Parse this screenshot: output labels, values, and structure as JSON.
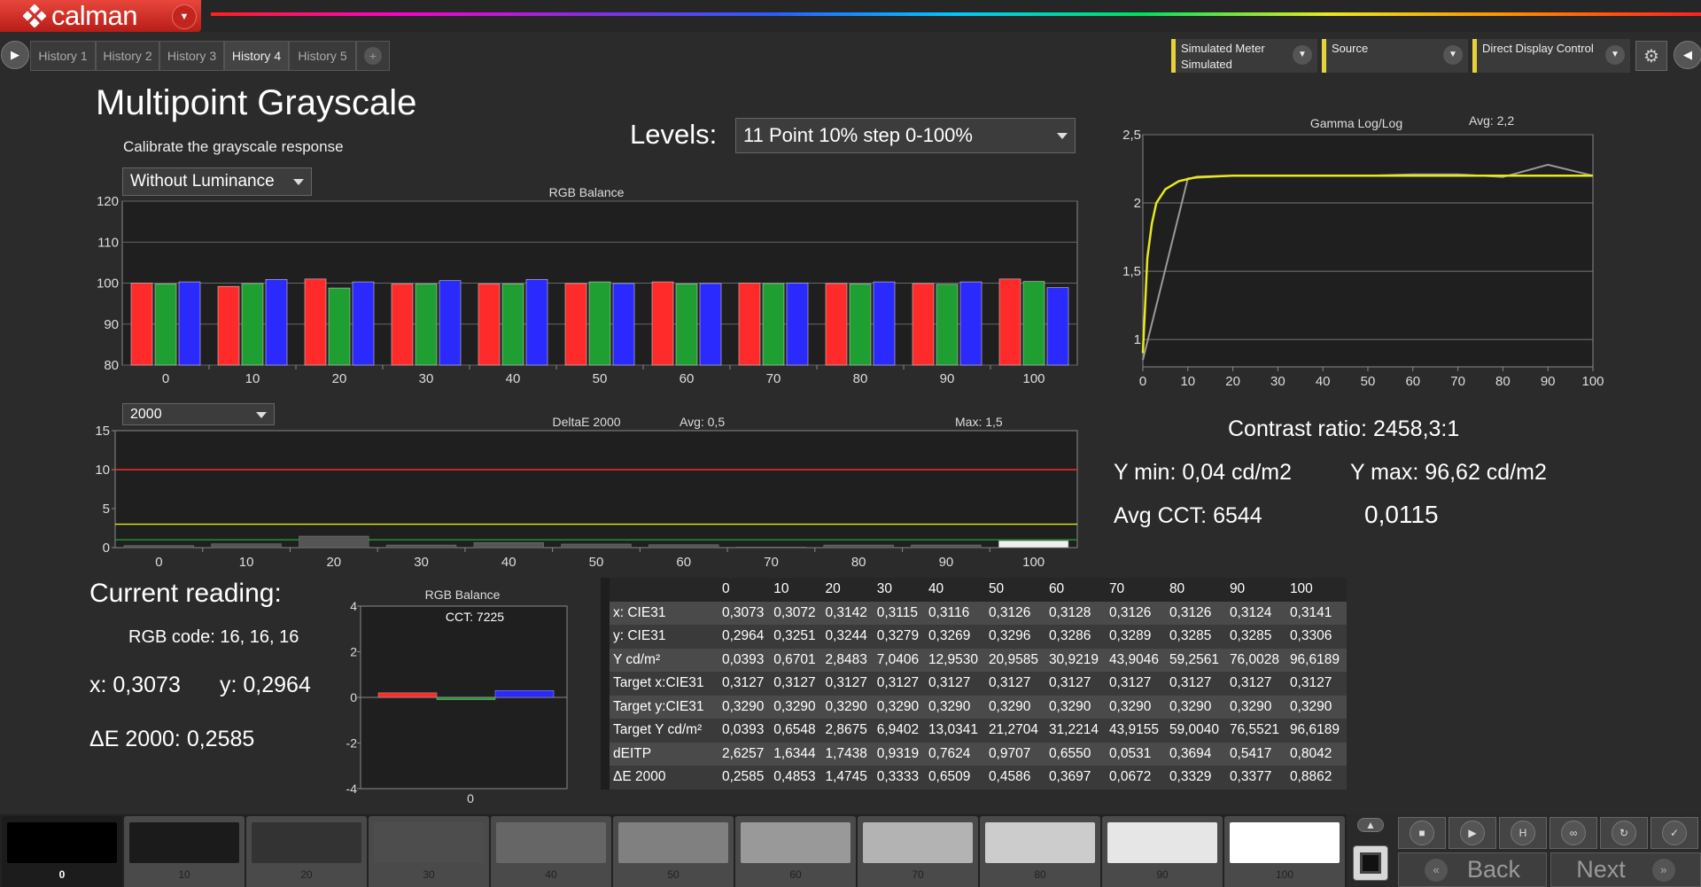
{
  "app": {
    "logo_text": "calman"
  },
  "history_tabs": [
    "History 1",
    "History 2",
    "History 3",
    "History 4",
    "History 5"
  ],
  "active_tab": 3,
  "devices": {
    "meter": {
      "line1": "Simulated Meter",
      "line2": "Simulated"
    },
    "source": {
      "line1": "Source",
      "line2": ""
    },
    "display": {
      "line1": "Direct Display Control",
      "line2": ""
    }
  },
  "page": {
    "title": "Multipoint Grayscale",
    "subtitle": "Calibrate the grayscale response",
    "levels_label": "Levels:",
    "levels_value": "11 Point 10% step 0-100%",
    "luminance_mode": "Without Luminance",
    "delta_formula": "2000"
  },
  "stats": {
    "contrast": "Contrast ratio: 2458,3:1",
    "ymin": "Y min: 0,04 cd/m2",
    "ymax": "Y max: 96,62 cd/m2",
    "avg_cct": "Avg CCT: 6544",
    "extra": "0,0115"
  },
  "current_reading": {
    "title": "Current reading:",
    "rgb": "RGB code: 16, 16, 16",
    "x": "x: 0,3073",
    "y": "y: 0,2964",
    "de": "ΔE 2000: 0,2585"
  },
  "colors": {
    "red": "#ff2a2a",
    "green": "#1f9e32",
    "blue": "#2a2aff",
    "yellow": "#e8e820",
    "accent": "#e6d23a"
  },
  "chart_data": [
    {
      "type": "bar",
      "title": "RGB Balance",
      "categories": [
        "0",
        "10",
        "20",
        "30",
        "40",
        "50",
        "60",
        "70",
        "80",
        "90",
        "100"
      ],
      "ylim": [
        80,
        120
      ],
      "yticks": [
        "80",
        "90",
        "100",
        "110",
        "120"
      ],
      "series": [
        {
          "name": "",
          "color": "#ff2a2a",
          "values": [
            100.0,
            99.2,
            101.0,
            99.8,
            99.8,
            99.9,
            100.3,
            100.0,
            99.9,
            99.9,
            101.0
          ]
        },
        {
          "name": "",
          "color": "#1f9e32",
          "values": [
            99.8,
            99.9,
            98.8,
            99.8,
            99.8,
            100.3,
            99.8,
            99.9,
            99.8,
            99.7,
            100.4
          ]
        },
        {
          "name": "",
          "color": "#2a2aff",
          "values": [
            100.3,
            100.9,
            100.3,
            100.6,
            100.9,
            99.9,
            99.9,
            100.0,
            100.3,
            100.3,
            98.9
          ]
        }
      ]
    },
    {
      "type": "bar",
      "title": "DeltaE 2000",
      "avg_label": "Avg: 0,5",
      "max_label": "Max: 1,5",
      "categories": [
        "0",
        "10",
        "20",
        "30",
        "40",
        "50",
        "60",
        "70",
        "80",
        "90",
        "100"
      ],
      "ylim": [
        0,
        15
      ],
      "yticks": [
        "0",
        "5",
        "10",
        "15"
      ],
      "thresholds": [
        {
          "value": 10,
          "color": "#ff2a2a"
        },
        {
          "value": 3,
          "color": "#e8e820"
        },
        {
          "value": 1,
          "color": "#1f9e32"
        }
      ],
      "values": [
        0.2585,
        0.4853,
        1.4745,
        0.3333,
        0.6509,
        0.4586,
        0.3697,
        0.0672,
        0.3329,
        0.3377,
        0.8862
      ]
    },
    {
      "type": "line",
      "title": "Gamma Log/Log",
      "avg_label": "Avg: 2,2",
      "x": [
        0,
        10,
        20,
        30,
        40,
        50,
        60,
        70,
        80,
        90,
        100
      ],
      "xticks": [
        "0",
        "10",
        "20",
        "30",
        "40",
        "50",
        "60",
        "70",
        "80",
        "90",
        "100"
      ],
      "ylim": [
        0.8,
        2.5
      ],
      "yticks": [
        {
          "v": 1,
          "label": "1"
        },
        {
          "v": 1.5,
          "label": "1,5"
        },
        {
          "v": 2,
          "label": "2"
        },
        {
          "v": 2.5,
          "label": "2,5"
        }
      ],
      "target": {
        "color": "#e8e820",
        "points": [
          [
            0,
            0.9
          ],
          [
            1,
            1.6
          ],
          [
            2,
            1.85
          ],
          [
            3,
            2.0
          ],
          [
            5,
            2.1
          ],
          [
            8,
            2.16
          ],
          [
            12,
            2.19
          ],
          [
            20,
            2.2
          ],
          [
            50,
            2.2
          ],
          [
            100,
            2.2
          ]
        ]
      },
      "measured": {
        "color": "#9a9a9a",
        "points": [
          [
            0,
            0.85
          ],
          [
            10,
            2.18
          ],
          [
            20,
            2.2
          ],
          [
            30,
            2.2
          ],
          [
            40,
            2.2
          ],
          [
            50,
            2.2
          ],
          [
            60,
            2.21
          ],
          [
            70,
            2.21
          ],
          [
            80,
            2.19
          ],
          [
            90,
            2.28
          ],
          [
            100,
            2.2
          ]
        ]
      }
    },
    {
      "type": "bar",
      "title": "RGB Balance",
      "cct_label": "CCT: 7225",
      "categories": [
        "0"
      ],
      "ylim": [
        -4,
        4
      ],
      "yticks": [
        "-4",
        "-2",
        "0",
        "2",
        "4"
      ],
      "values": [
        {
          "color": "#ff2a2a",
          "v": 0.2
        },
        {
          "color": "#1f9e32",
          "v": -0.1
        },
        {
          "color": "#2a2aff",
          "v": 0.3
        }
      ]
    }
  ],
  "table": {
    "columns": [
      "0",
      "10",
      "20",
      "30",
      "40",
      "50",
      "60",
      "70",
      "80",
      "90",
      "100"
    ],
    "rows": [
      {
        "label": "x: CIE31",
        "values": [
          "0,3073",
          "0,3072",
          "0,3142",
          "0,3115",
          "0,3116",
          "0,3126",
          "0,3128",
          "0,3126",
          "0,3126",
          "0,3124",
          "0,3141"
        ]
      },
      {
        "label": "y: CIE31",
        "values": [
          "0,2964",
          "0,3251",
          "0,3244",
          "0,3279",
          "0,3269",
          "0,3296",
          "0,3286",
          "0,3289",
          "0,3285",
          "0,3285",
          "0,3306"
        ]
      },
      {
        "label": "Y cd/m²",
        "values": [
          "0,0393",
          "0,6701",
          "2,8483",
          "7,0406",
          "12,9530",
          "20,9585",
          "30,9219",
          "43,9046",
          "59,2561",
          "76,0028",
          "96,6189"
        ]
      },
      {
        "label": "Target x:CIE31",
        "values": [
          "0,3127",
          "0,3127",
          "0,3127",
          "0,3127",
          "0,3127",
          "0,3127",
          "0,3127",
          "0,3127",
          "0,3127",
          "0,3127",
          "0,3127"
        ]
      },
      {
        "label": "Target y:CIE31",
        "values": [
          "0,3290",
          "0,3290",
          "0,3290",
          "0,3290",
          "0,3290",
          "0,3290",
          "0,3290",
          "0,3290",
          "0,3290",
          "0,3290",
          "0,3290"
        ]
      },
      {
        "label": "Target Y cd/m²",
        "values": [
          "0,0393",
          "0,6548",
          "2,8675",
          "6,9402",
          "13,0341",
          "21,2704",
          "31,2214",
          "43,9155",
          "59,0040",
          "76,5521",
          "96,6189"
        ]
      },
      {
        "label": "dEITP",
        "values": [
          "2,6257",
          "1,6344",
          "1,7438",
          "0,9319",
          "0,7624",
          "0,9707",
          "0,6550",
          "0,0531",
          "0,3694",
          "0,5417",
          "0,8042"
        ]
      },
      {
        "label": "ΔE 2000",
        "values": [
          "0,2585",
          "0,4853",
          "1,4745",
          "0,3333",
          "0,6509",
          "0,4586",
          "0,3697",
          "0,0672",
          "0,3329",
          "0,3377",
          "0,8862"
        ]
      }
    ]
  },
  "swatches": [
    {
      "label": "0",
      "color": "#000000"
    },
    {
      "label": "10",
      "color": "#1b1b1b"
    },
    {
      "label": "20",
      "color": "#333333"
    },
    {
      "label": "30",
      "color": "#4d4d4d"
    },
    {
      "label": "40",
      "color": "#666666"
    },
    {
      "label": "50",
      "color": "#808080"
    },
    {
      "label": "60",
      "color": "#999999"
    },
    {
      "label": "70",
      "color": "#b3b3b3"
    },
    {
      "label": "80",
      "color": "#cccccc"
    },
    {
      "label": "90",
      "color": "#e6e6e6"
    },
    {
      "label": "100",
      "color": "#ffffff"
    }
  ],
  "active_swatch": 0,
  "nav": {
    "back": "Back",
    "next": "Next"
  },
  "icons": {
    "play": "play-icon",
    "gear": "gear-icon",
    "stop": "stop-icon",
    "loop": "loop-icon",
    "save": "save-icon",
    "check": "check-icon"
  }
}
